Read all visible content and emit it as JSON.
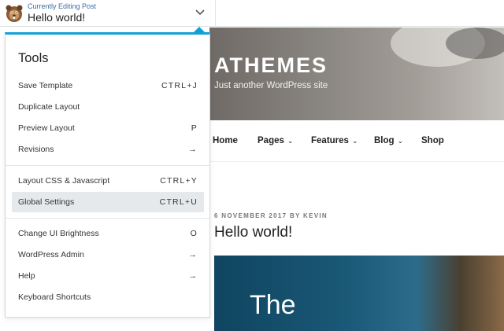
{
  "topbar": {
    "label": "Currently Editing Post",
    "post_title": "Hello world!"
  },
  "site": {
    "title": "ATHEMES",
    "tagline": "Just another WordPress site",
    "nav": [
      {
        "label": "Home",
        "has_caret": false
      },
      {
        "label": "Pages",
        "has_caret": true
      },
      {
        "label": "Features",
        "has_caret": true
      },
      {
        "label": "Blog",
        "has_caret": true
      },
      {
        "label": "Shop",
        "has_caret": false
      }
    ],
    "post_meta": "6 NOVEMBER 2017 BY KEVIN",
    "post_title": "Hello world!",
    "featured_text": "The"
  },
  "tools": {
    "heading": "Tools",
    "items": [
      {
        "label": "Save Template",
        "shortcut": "CTRL+J"
      },
      {
        "label": "Duplicate Layout",
        "shortcut": ""
      },
      {
        "label": "Preview Layout",
        "shortcut": "P"
      },
      {
        "label": "Revisions",
        "shortcut": "→"
      },
      {
        "label": "Layout CSS & Javascript",
        "shortcut": "CTRL+Y"
      },
      {
        "label": "Global Settings",
        "shortcut": "CTRL+U",
        "active": true
      },
      {
        "label": "Change UI Brightness",
        "shortcut": "O"
      },
      {
        "label": "WordPress Admin",
        "shortcut": "→"
      },
      {
        "label": "Help",
        "shortcut": "→"
      },
      {
        "label": "Keyboard Shortcuts",
        "shortcut": ""
      }
    ]
  },
  "colors": {
    "accent": "#11a0d7",
    "active_item_bg": "#e6e9ec"
  },
  "icons": {
    "logo": "beaver-logo-icon",
    "dropdown": "chevron-down-icon"
  }
}
